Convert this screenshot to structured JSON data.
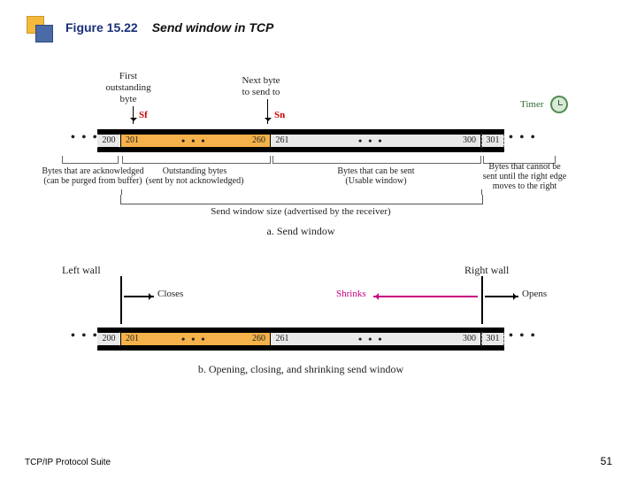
{
  "figure_number": "Figure 15.22",
  "figure_title": "Send window in TCP",
  "footer_text": "TCP/IP Protocol Suite",
  "page_number": "51",
  "timer_label": "Timer",
  "partA": {
    "label_first_byte": "First\noutstanding\nbyte",
    "label_next_byte": "Next byte\nto send to",
    "sf": "Sf",
    "sn": "Sn",
    "left_before": "200",
    "win_start": "201",
    "sent_end": "260",
    "usable_start": "261",
    "win_end": "300",
    "right_after": "301",
    "region1": "Bytes that are acknowledged\n(can be purged from buffer)",
    "region2": "Outstanding bytes\n(sent by not acknowledged)",
    "region3": "Bytes that can be sent\n(Usable window)",
    "region4": "Bytes that cannot be\nsent until the right edge\nmoves to the right",
    "window_size_label": "Send window size (advertised by the receiver)",
    "caption": "a. Send window"
  },
  "partB": {
    "left_wall": "Left wall",
    "right_wall": "Right wall",
    "closes": "Closes",
    "shrinks": "Shrinks",
    "opens": "Opens",
    "left_before": "200",
    "win_start": "201",
    "sent_end": "260",
    "usable_start": "261",
    "win_end": "300",
    "right_after": "301",
    "caption": "b. Opening, closing, and shrinking send window"
  }
}
